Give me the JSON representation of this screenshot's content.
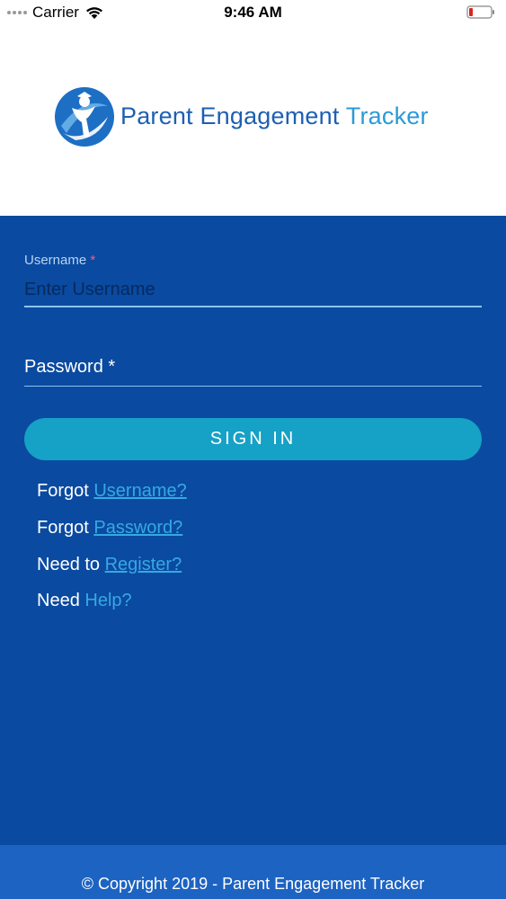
{
  "status_bar": {
    "carrier": "Carrier",
    "time": "9:46 AM",
    "wifi_icon": "wifi-icon",
    "battery_icon": "battery-low-icon"
  },
  "logo": {
    "text_part1": "Parent Engagement ",
    "text_part2": "Tracker",
    "icon": "graduate-figure-logo",
    "colors": {
      "primary": "#1d5fb2",
      "secondary": "#2b9ad8"
    }
  },
  "form": {
    "username_label": "Username",
    "required_mark": "*",
    "username_placeholder": "Enter Username",
    "username_value": "",
    "password_label": "Password *",
    "signin_label": "SIGN IN"
  },
  "links": {
    "forgot_username_prefix": "Forgot ",
    "forgot_username_link": "Username?",
    "forgot_password_prefix": "Forgot ",
    "forgot_password_link": "Password?",
    "register_prefix": "Need to ",
    "register_link": "Register?",
    "help_prefix": "Need ",
    "help_link": "Help?"
  },
  "footer": {
    "copyright": "© Copyright 2019 - Parent Engagement Tracker"
  },
  "colors": {
    "panel_bg": "#0a4aa0",
    "button_bg": "#16a1c6",
    "footer_bg": "#1d63c2",
    "link": "#36a9e2",
    "required": "#ff5c7a"
  }
}
